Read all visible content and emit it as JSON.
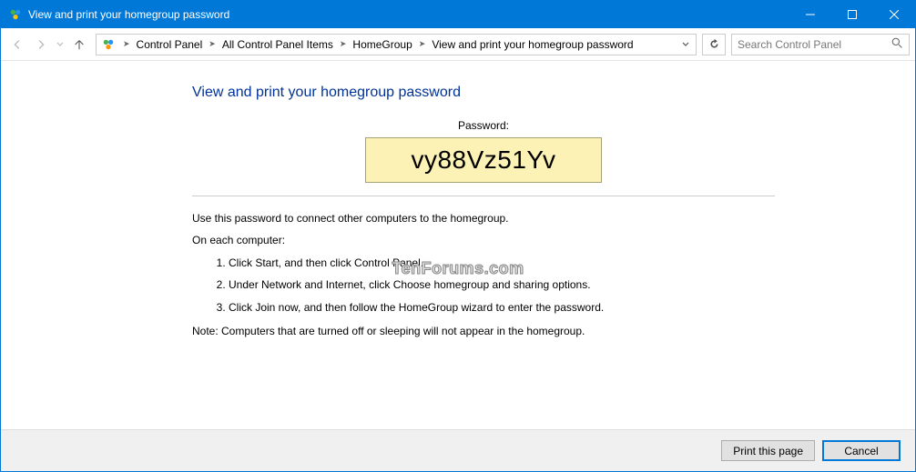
{
  "titlebar": {
    "title": "View and print your homegroup password"
  },
  "breadcrumb": {
    "items": [
      "Control Panel",
      "All Control Panel Items",
      "HomeGroup",
      "View and print your homegroup password"
    ]
  },
  "search": {
    "placeholder": "Search Control Panel"
  },
  "main": {
    "heading": "View and print your homegroup password",
    "password_label": "Password:",
    "password": "vy88Vz51Yv",
    "instructions_intro": "Use this password to connect other computers to the homegroup.",
    "on_each": "On each computer:",
    "steps": [
      "Click Start, and then click Control Panel.",
      "Under Network and Internet, click Choose homegroup and sharing options.",
      "Click Join now, and then follow the HomeGroup wizard to enter the password."
    ],
    "note": "Note: Computers that are turned off or sleeping will not appear in the homegroup."
  },
  "footer": {
    "print_label": "Print this page",
    "cancel_label": "Cancel"
  },
  "watermark": "TenForums.com"
}
